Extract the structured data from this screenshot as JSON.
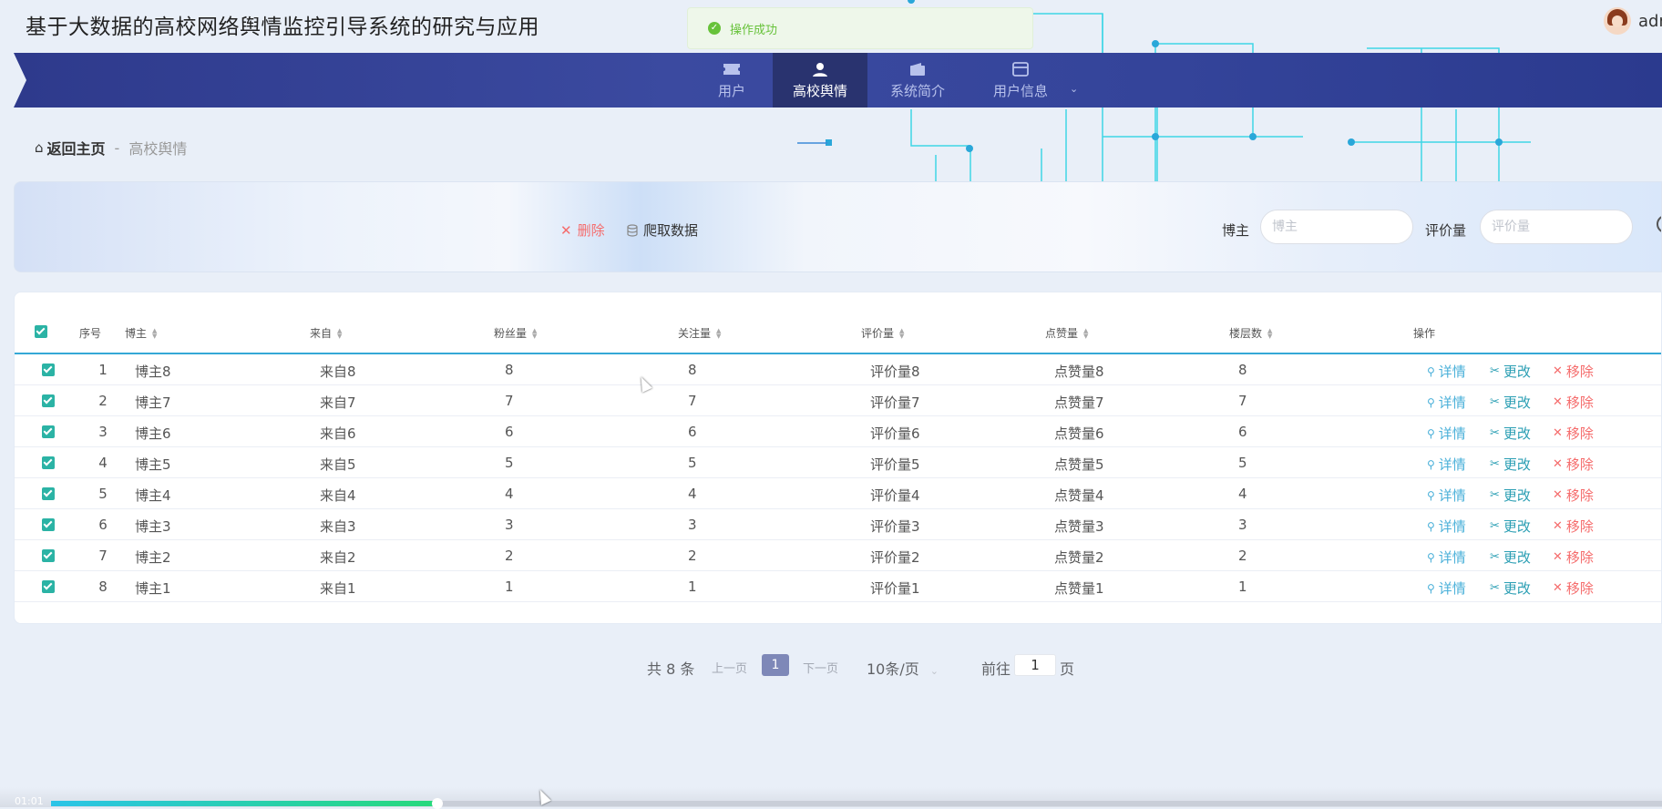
{
  "header": {
    "site_title": "基于大数据的高校网络舆情监控引导系统的研究与应用",
    "user_name": "adm"
  },
  "toast": {
    "message": "操作成功",
    "icon": "check-circle-icon"
  },
  "nav": {
    "items": [
      {
        "label": "用户",
        "icon": "ticket-icon",
        "active": false
      },
      {
        "label": "高校舆情",
        "icon": "user-icon",
        "active": true
      },
      {
        "label": "系统简介",
        "icon": "wallet-icon",
        "active": false
      },
      {
        "label": "用户信息",
        "icon": "window-icon",
        "active": false
      }
    ],
    "more_icon": "chevron-down-icon"
  },
  "breadcrumb": {
    "home": "返回主页",
    "separator": "-",
    "current": "高校舆情"
  },
  "toolbar": {
    "delete_label": "删除",
    "crawl_label": "爬取数据",
    "filter_blogger_label": "博主",
    "filter_blogger_placeholder": "博主",
    "filter_blogger_value": "",
    "filter_eval_label": "评价量",
    "filter_eval_placeholder": "评价量",
    "filter_eval_value": ""
  },
  "table": {
    "columns": [
      "序号",
      "博主",
      "来自",
      "粉丝量",
      "关注量",
      "评价量",
      "点赞量",
      "楼层数",
      "操作"
    ],
    "actions": {
      "detail": "详情",
      "edit": "更改",
      "remove": "移除"
    },
    "rows": [
      {
        "index": "1",
        "blogger": "博主8",
        "source": "来自8",
        "fans": "8",
        "follows": "8",
        "evals": "评价量8",
        "likes": "点赞量8",
        "floors": "8"
      },
      {
        "index": "2",
        "blogger": "博主7",
        "source": "来自7",
        "fans": "7",
        "follows": "7",
        "evals": "评价量7",
        "likes": "点赞量7",
        "floors": "7"
      },
      {
        "index": "3",
        "blogger": "博主6",
        "source": "来自6",
        "fans": "6",
        "follows": "6",
        "evals": "评价量6",
        "likes": "点赞量6",
        "floors": "6"
      },
      {
        "index": "4",
        "blogger": "博主5",
        "source": "来自5",
        "fans": "5",
        "follows": "5",
        "evals": "评价量5",
        "likes": "点赞量5",
        "floors": "5"
      },
      {
        "index": "5",
        "blogger": "博主4",
        "source": "来自4",
        "fans": "4",
        "follows": "4",
        "evals": "评价量4",
        "likes": "点赞量4",
        "floors": "4"
      },
      {
        "index": "6",
        "blogger": "博主3",
        "source": "来自3",
        "fans": "3",
        "follows": "3",
        "evals": "评价量3",
        "likes": "点赞量3",
        "floors": "3"
      },
      {
        "index": "7",
        "blogger": "博主2",
        "source": "来自2",
        "fans": "2",
        "follows": "2",
        "evals": "评价量2",
        "likes": "点赞量2",
        "floors": "2"
      },
      {
        "index": "8",
        "blogger": "博主1",
        "source": "来自1",
        "fans": "1",
        "follows": "1",
        "evals": "评价量1",
        "likes": "点赞量1",
        "floors": "1"
      }
    ]
  },
  "pagination": {
    "total_text": "共 8 条",
    "prev_label": "上一页",
    "current_page": "1",
    "next_label": "下一页",
    "page_size": "10条/页",
    "goto_label": "前往",
    "goto_value": "1",
    "goto_suffix": "页"
  },
  "video": {
    "time": "01:01",
    "progress": 0.24
  },
  "colors": {
    "nav_bg": "#34449a",
    "accent": "#2bb3a5",
    "danger": "#f56c6c",
    "link": "#4ab0d9"
  }
}
